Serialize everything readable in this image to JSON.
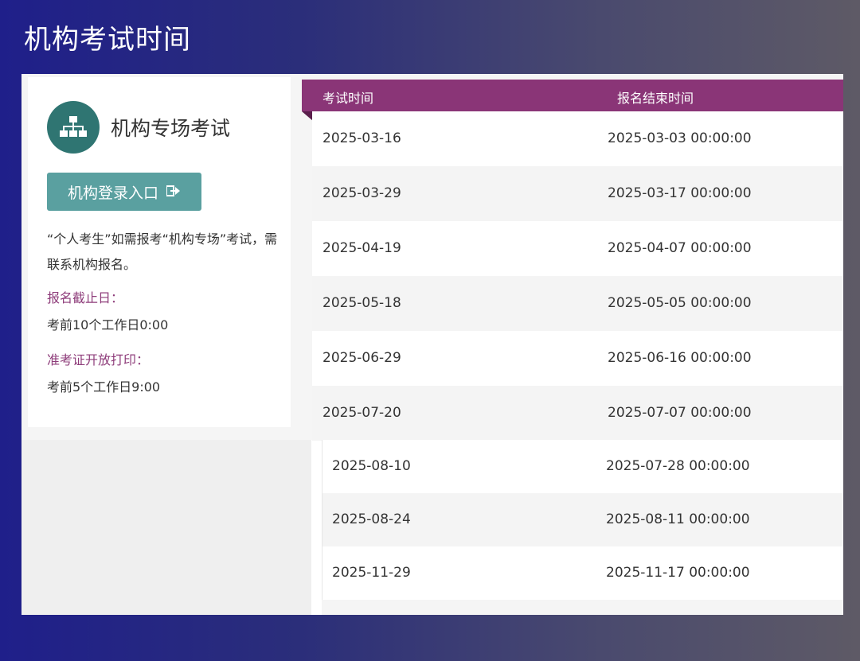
{
  "page": {
    "title": "机构考试时间"
  },
  "org": {
    "title": "机构专场考试",
    "icon": "org-chart-icon",
    "login_label": "机构登录入口",
    "login_icon": "sign-in-icon",
    "note": "“个人考生”如需报考“机构专场”考试，需联系机构报名。",
    "deadline_label": "报名截止日：",
    "deadline_value": "考前10个工作日0:00",
    "print_label": "准考证开放打印：",
    "print_value": "考前5个工作日9:00"
  },
  "table": {
    "headers": [
      "考试时间",
      "报名结束时间"
    ],
    "rows": [
      [
        "2025-03-16",
        "2025-03-03 00:00:00"
      ],
      [
        "2025-03-29",
        "2025-03-17 00:00:00"
      ],
      [
        "2025-04-19",
        "2025-04-07 00:00:00"
      ],
      [
        "2025-05-18",
        "2025-05-05 00:00:00"
      ],
      [
        "2025-06-29",
        "2025-06-16 00:00:00"
      ],
      [
        "2025-07-20",
        "2025-07-07 00:00:00"
      ]
    ],
    "rows2": [
      [
        "2025-08-10",
        "2025-07-28 00:00:00"
      ],
      [
        "2025-08-24",
        "2025-08-11 00:00:00"
      ],
      [
        "2025-11-29",
        "2025-11-17 00:00:00"
      ]
    ]
  },
  "colors": {
    "accent": "#8a3577",
    "teal": "#2f7572",
    "button": "#5aa0a0"
  }
}
